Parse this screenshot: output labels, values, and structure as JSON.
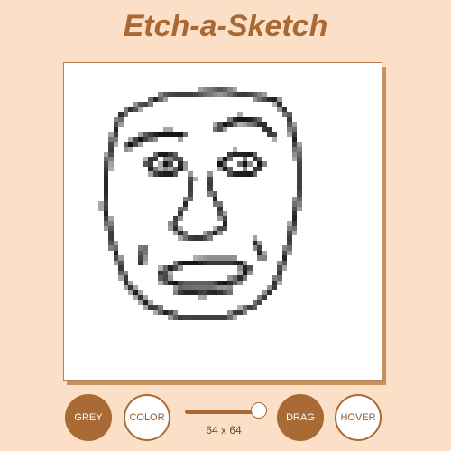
{
  "app": {
    "title": "Etch-a-Sketch"
  },
  "board": {
    "grid_size": 64,
    "background": "#ffffff",
    "ink_color": "#1a1a1a",
    "description_icon": "drawn-face"
  },
  "controls": {
    "grey_label": "GREY",
    "color_label": "COLOR",
    "drag_label": "DRAG",
    "hover_label": "HOVER",
    "size_label": "64 x 64",
    "slider_value": 64,
    "slider_min": 16,
    "slider_max": 64,
    "active_mode": "GREY",
    "active_draw": "DRAG"
  },
  "colors": {
    "background": "#fcdfc7",
    "accent": "#a96b35",
    "title": "#a86934"
  }
}
